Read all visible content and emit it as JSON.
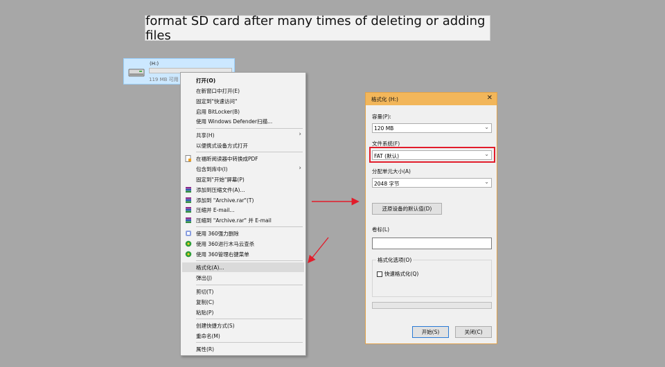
{
  "banner": {
    "title": "format SD card after many times of deleting or adding files"
  },
  "drive": {
    "name": "(H:)",
    "free_text": "119 MB 可用"
  },
  "context_menu": {
    "items": {
      "open": "打开(O)",
      "open_new_window": "在新窗口中打开(E)",
      "pin_quick_access": "固定到\"快速访问\"",
      "bitlocker": "启用 BitLocker(B)",
      "defender": "使用 Windows Defender扫描...",
      "share": "共享(H)",
      "portable_open": "以便携式设备方式打开",
      "convert_pdf": "在福昕阅读器中转换成PDF",
      "include_library": "包含到库中(I)",
      "pin_start": "固定到\"开始\"屏幕(P)",
      "add_archive": "添加到压缩文件(A)...",
      "add_archive_rar": "添加到 \"Archive.rar\"(T)",
      "compress_email": "压缩并 E-mail...",
      "compress_rar_email": "压缩到 \"Archive.rar\" 并 E-mail",
      "delete_360": "使用 360强力删除",
      "scan_360": "使用 360进行木马云查杀",
      "manage_360": "使用 360管理右键菜单",
      "format": "格式化(A)...",
      "eject": "弹出(J)",
      "cut": "剪切(T)",
      "copy": "复制(C)",
      "paste": "粘贴(P)",
      "create_shortcut": "创建快捷方式(S)",
      "rename": "重命名(M)",
      "properties": "属性(R)"
    }
  },
  "dialog": {
    "title": "格式化 (H:)",
    "close": "✕",
    "capacity_label": "容量(P):",
    "capacity_value": "120 MB",
    "fs_label": "文件系统(F)",
    "fs_value": "FAT (默认)",
    "alloc_label": "分配单元大小(A)",
    "alloc_value": "2048 字节",
    "restore_button": "还原设备的默认值(D)",
    "volume_label": "卷标(L)",
    "volume_value": "",
    "options_label": "格式化选项(O)",
    "quick_format": "快速格式化(Q)",
    "start_button": "开始(S)",
    "close_button": "关闭(C)"
  },
  "colors": {
    "background": "#a7a7a7",
    "dialog_titlebar": "#f2b65a",
    "highlight_box": "#e21c2a",
    "arrow": "#e21c2a"
  }
}
